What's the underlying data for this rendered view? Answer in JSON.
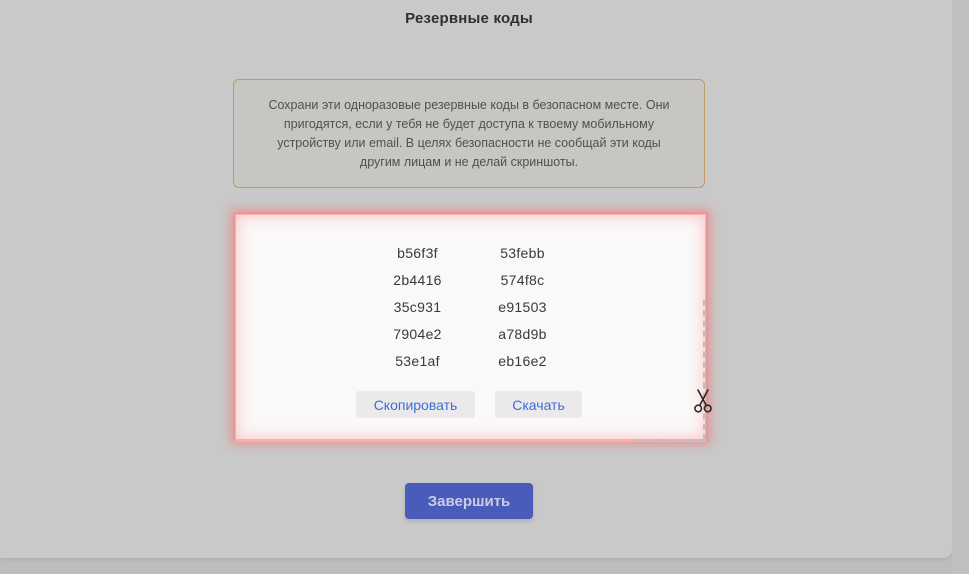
{
  "page": {
    "title": "Резервные коды"
  },
  "warning": {
    "text": "Сохрани эти одноразовые резервные коды в безопасном месте. Они пригодятся, если у тебя не будет доступа к твоему мобильному устройству или email. В целях безопасности не сообщай эти коды другим лицам и не делай скриншоты."
  },
  "codes": [
    "b56f3f",
    "53febb",
    "2b4416",
    "574f8c",
    "35c931",
    "e91503",
    "7904e2",
    "a78d9b",
    "53e1af",
    "eb16e2"
  ],
  "actions": {
    "copy_label": "Скопировать",
    "download_label": "Скачать",
    "finish_label": "Завершить"
  },
  "icons": {
    "scissors": "scissors-icon"
  },
  "colors": {
    "overlay": "#c9c9c9",
    "accent_link": "#3c6fd6",
    "primary_button": "#4a5cba",
    "warning_border": "#c09a63",
    "selection_glow": "#ff6e6e"
  }
}
